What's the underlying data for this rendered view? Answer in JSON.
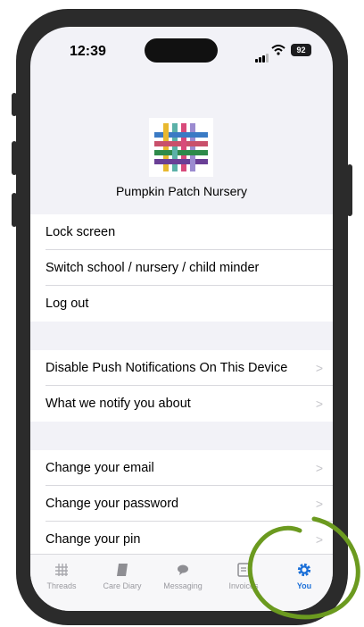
{
  "status_bar": {
    "time": "12:39",
    "battery": "92"
  },
  "header": {
    "school_name": "Pumpkin Patch Nursery"
  },
  "menu": {
    "group1": [
      {
        "label": "Lock screen"
      },
      {
        "label": "Switch school / nursery / child minder"
      },
      {
        "label": "Log out"
      }
    ],
    "group2": [
      {
        "label": "Disable Push Notifications On This Device"
      },
      {
        "label": "What we notify you about"
      }
    ],
    "group3": [
      {
        "label": "Change your email"
      },
      {
        "label": "Change your password"
      },
      {
        "label": "Change your pin"
      }
    ]
  },
  "tabbar": {
    "items": [
      {
        "label": "Threads",
        "icon": "threads-icon"
      },
      {
        "label": "Care Diary",
        "icon": "book-icon"
      },
      {
        "label": "Messaging",
        "icon": "chat-bubble-icon"
      },
      {
        "label": "Invoices",
        "icon": "invoice-icon"
      },
      {
        "label": "You",
        "icon": "gear-icon"
      }
    ],
    "active_index": 4
  },
  "colors": {
    "accent": "#1a6fd8",
    "highlight_circle": "#6b9a1f"
  }
}
